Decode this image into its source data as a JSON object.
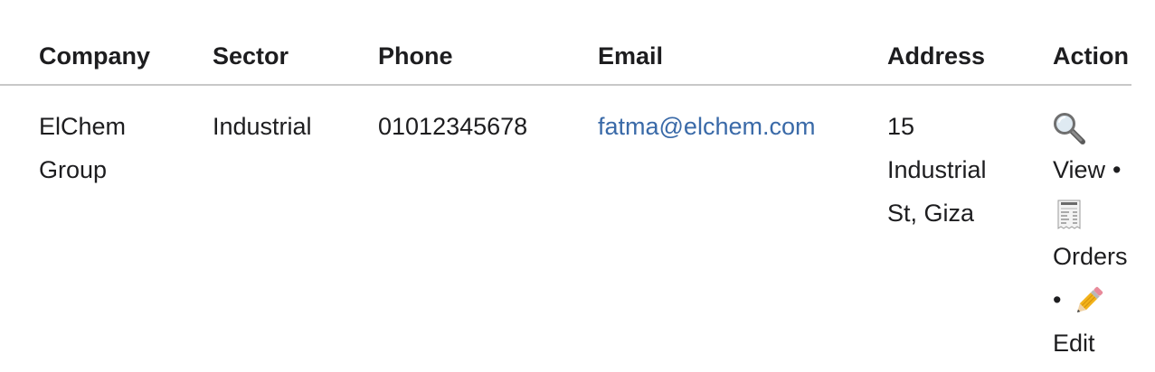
{
  "table": {
    "headers": {
      "company": "Company",
      "sector": "Sector",
      "phone": "Phone",
      "email": "Email",
      "address": "Address",
      "action": "Action"
    },
    "rows": [
      {
        "company_line1": "ElChem",
        "company_line2": "Group",
        "sector": "Industrial",
        "phone": "01012345678",
        "email": "fatma@elchem.com",
        "address_line1": "15",
        "address_line2": "Industrial",
        "address_line3": "St, Giza",
        "actions": {
          "view_label": "View",
          "view_icon": "magnifying-glass-icon",
          "orders_label": "Orders",
          "orders_icon": "receipt-icon",
          "edit_label": "Edit",
          "edit_icon": "pencil-icon",
          "separator": "•"
        }
      }
    ]
  },
  "colors": {
    "link": "#3a6aa8",
    "divider": "#c8c8c8",
    "text": "#1d1d1f"
  }
}
